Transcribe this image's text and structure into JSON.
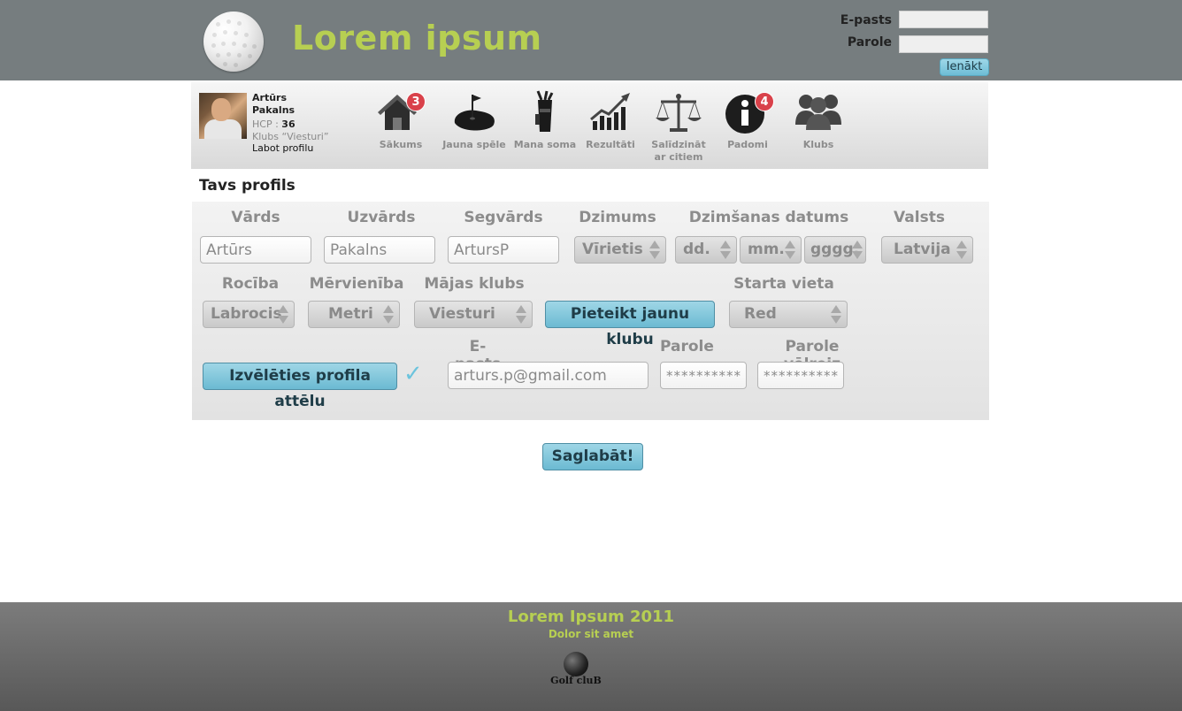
{
  "header": {
    "title": "Lorem ipsum",
    "email_label": "E-pasts",
    "password_label": "Parole",
    "login_button": "Ienākt"
  },
  "profile_card": {
    "first_name": "Artūrs",
    "last_name": "Pakalns",
    "hcp_label": "HCP :",
    "hcp_value": "36",
    "club": "Klubs “Viesturi”",
    "edit_link": "Labot profilu"
  },
  "nav": {
    "items": [
      {
        "label": "Sākums",
        "icon": "home-icon",
        "badge": "3"
      },
      {
        "label": "Jauna spēle",
        "icon": "putting-green-icon"
      },
      {
        "label": "Mana soma",
        "icon": "golf-bag-icon"
      },
      {
        "label": "Rezultāti",
        "icon": "chart-icon"
      },
      {
        "label": "Salīdzināt",
        "label2": "ar citiem",
        "icon": "scales-icon"
      },
      {
        "label": "Padomi",
        "icon": "info-icon",
        "badge": "4"
      },
      {
        "label": "Klubs",
        "icon": "group-icon"
      }
    ]
  },
  "section": {
    "title": "Tavs profils"
  },
  "form": {
    "first_name_label": "Vārds",
    "first_name_value": "Artūrs",
    "last_name_label": "Uzvārds",
    "last_name_value": "Pakalns",
    "nickname_label": "Segvārds",
    "nickname_value": "ArtursP",
    "gender_label": "Dzimums",
    "gender_value": "Vīrietis",
    "birthdate_label": "Dzimšanas datums",
    "day_value": "dd.",
    "month_value": "mm.",
    "year_value": "gggg.",
    "country_label": "Valsts",
    "country_value": "Latvija",
    "hand_label": "Rocība",
    "hand_value": "Labrocis",
    "units_label": "Mērvienība",
    "units_value": "Metri",
    "home_club_label": "Mājas klubs",
    "home_club_value": "Viesturi",
    "register_club_button": "Pieteikt jaunu klubu",
    "tee_label": "Starta vieta",
    "tee_value": "Red",
    "choose_picture_button": "Izvēlēties profila attēlu",
    "check_mark": "✓",
    "email_label": "E-pasts",
    "email_value": "arturs.p@gmail.com",
    "password_label": "Parole",
    "password_value": "**********",
    "password_repeat_label": "Parole vēlreiz",
    "password_repeat_value": "**********"
  },
  "save_button": "Saglabāt!",
  "footer": {
    "line1": "Lorem Ipsum 2011",
    "line2": "Dolor sit amet",
    "logo_text": "Golf cluB"
  },
  "colors": {
    "header_bg": "#767d7f",
    "accent_green": "#b7cf52",
    "button_blue": "#6bbad2",
    "badge_red": "#d9414a"
  }
}
